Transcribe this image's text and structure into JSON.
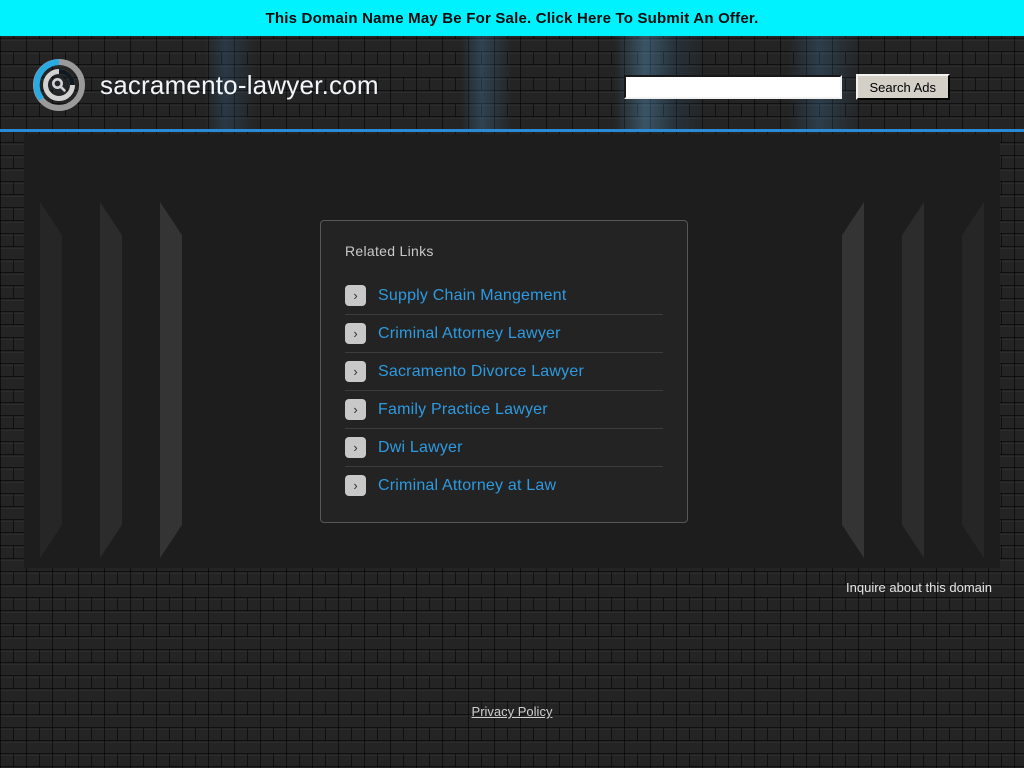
{
  "banner": {
    "text": "This Domain Name May Be For Sale. Click Here To Submit An Offer.",
    "background_color": "#00f2ff",
    "text_color": "#0a0a0a"
  },
  "header": {
    "domain_title": "sacramento-lawyer.com",
    "logo_icon": "circular-target-logo",
    "accent_color": "#2b8ad6",
    "search": {
      "value": "",
      "placeholder": "",
      "button_label": "Search Ads"
    }
  },
  "main": {
    "related_links": {
      "heading": "Related Links",
      "items": [
        {
          "label": "Supply Chain Mangement",
          "icon": "chevron-right-icon"
        },
        {
          "label": "Criminal Attorney Lawyer",
          "icon": "chevron-right-icon"
        },
        {
          "label": "Sacramento Divorce Lawyer",
          "icon": "chevron-right-icon"
        },
        {
          "label": "Family Practice Lawyer",
          "icon": "chevron-right-icon"
        },
        {
          "label": "Dwi Lawyer",
          "icon": "chevron-right-icon"
        },
        {
          "label": "Criminal Attorney at Law",
          "icon": "chevron-right-icon"
        }
      ],
      "link_color": "#2e9ae0"
    },
    "decoration": {
      "left_icon": "chevrons-right-decoration",
      "right_icon": "chevrons-left-decoration"
    }
  },
  "footer": {
    "inquire_label": "Inquire about this domain",
    "privacy_label": "Privacy Policy"
  }
}
